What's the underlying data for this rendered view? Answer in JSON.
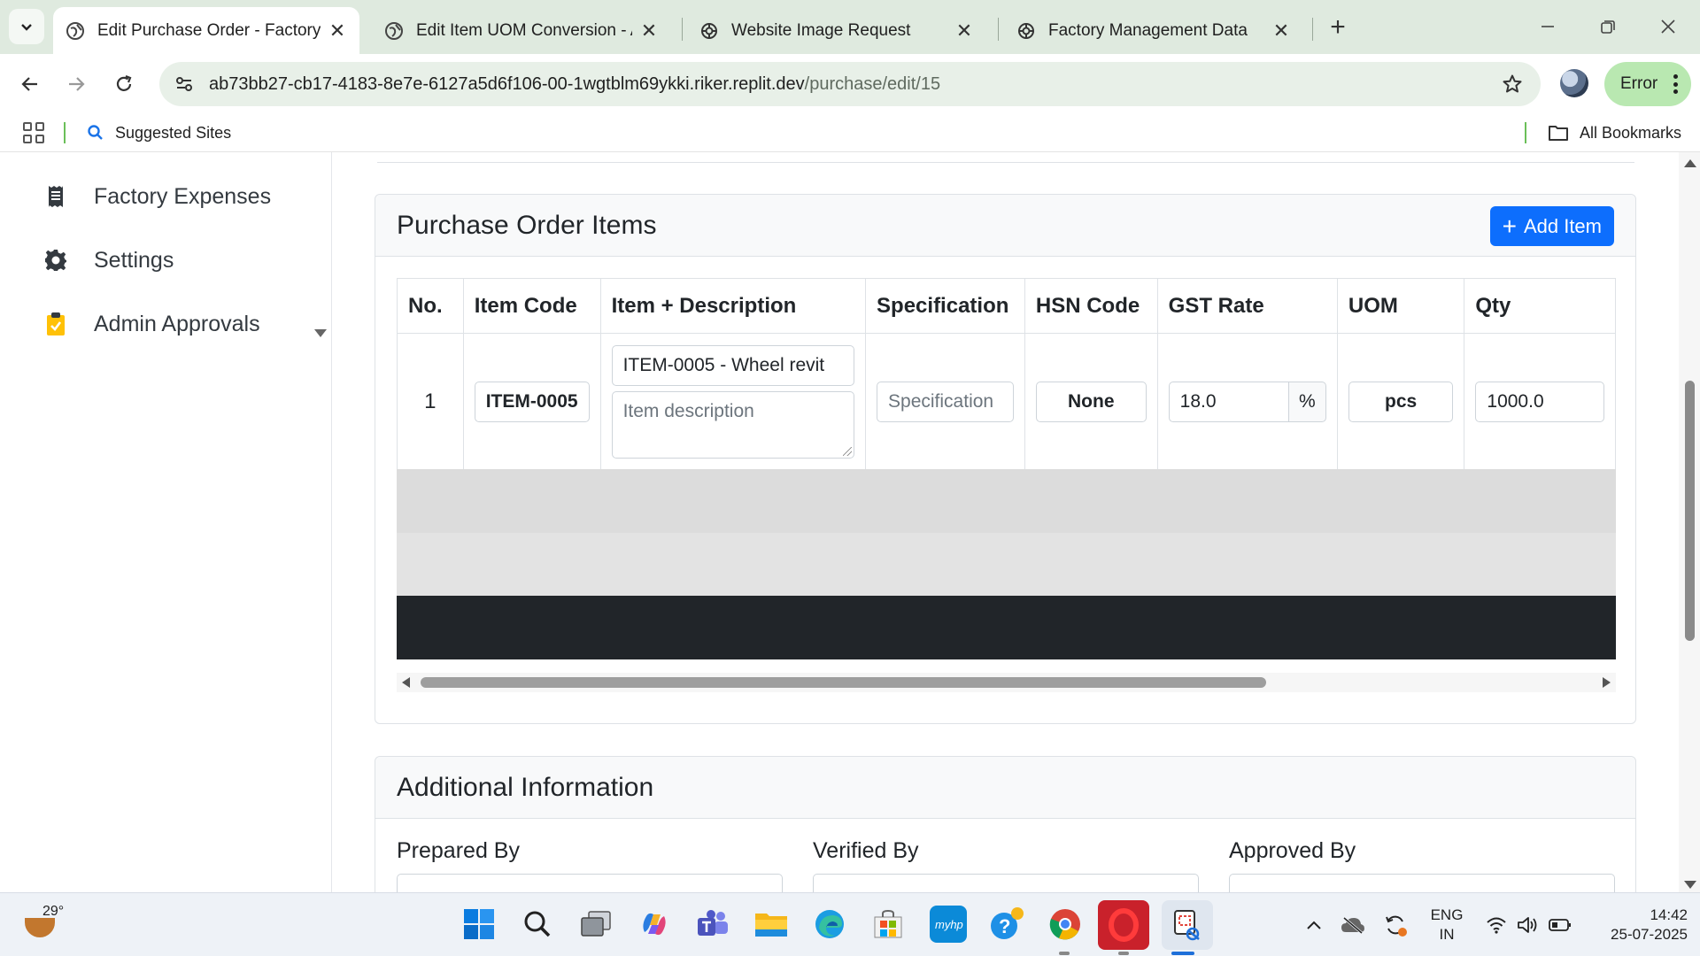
{
  "browser": {
    "tabs": [
      {
        "title": "Edit Purchase Order - Factory M",
        "favicon": "globe-icon",
        "active": true
      },
      {
        "title": "Edit Item UOM Conversion - AK",
        "favicon": "globe-icon",
        "active": false
      },
      {
        "title": "Website Image Request",
        "favicon": "chatgpt-icon",
        "active": false
      },
      {
        "title": "Factory Management Data",
        "favicon": "chatgpt-icon",
        "active": false
      }
    ],
    "url_host": "ab73bb27-cb17-4183-8e7e-6127a5d6f106-00-1wgtblm69ykki.riker.replit.dev",
    "url_path": "/purchase/edit/15",
    "profile_status": "Error",
    "bookmarks": {
      "suggested": "Suggested Sites",
      "all": "All Bookmarks"
    }
  },
  "sidebar": {
    "items": [
      {
        "label": "Factory Expenses",
        "icon": "receipt-icon"
      },
      {
        "label": "Settings",
        "icon": "gear-icon"
      },
      {
        "label": "Admin Approvals",
        "icon": "clipboard-check-icon"
      }
    ]
  },
  "po_items": {
    "title": "Purchase Order Items",
    "add_button": "Add Item",
    "columns": [
      "No.",
      "Item Code",
      "Item + Description",
      "Specification",
      "HSN Code",
      "GST Rate",
      "UOM",
      "Qty"
    ],
    "rows": [
      {
        "no": "1",
        "item_code": "ITEM-0005",
        "item_name": "ITEM-0005 - Wheel revit",
        "description_placeholder": "Item description",
        "specification_placeholder": "Specification",
        "hsn_code": "None",
        "gst_rate": "18.0",
        "gst_suffix": "%",
        "uom": "pcs",
        "qty": "1000.0"
      }
    ]
  },
  "additional_info": {
    "title": "Additional Information",
    "prepared_by": "Prepared By",
    "verified_by": "Verified By",
    "approved_by": "Approved By"
  },
  "taskbar": {
    "temperature": "29°",
    "lang_top": "ENG",
    "lang_bottom": "IN",
    "time": "14:42",
    "date": "25-07-2025"
  },
  "colors": {
    "primary": "#0d6efd",
    "chrome_bg": "#dfeadf",
    "error_pill": "#b9e8b1",
    "dark_row": "#212529"
  }
}
